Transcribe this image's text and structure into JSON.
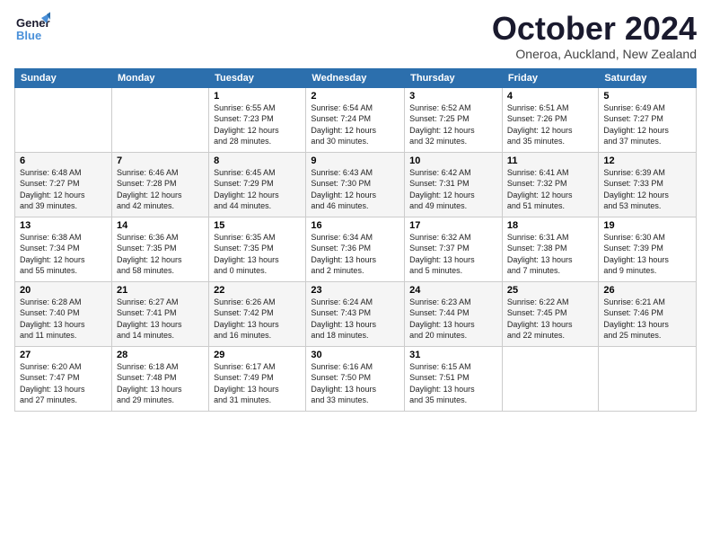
{
  "logo": {
    "line1": "General",
    "line2": "Blue"
  },
  "title": "October 2024",
  "location": "Oneroa, Auckland, New Zealand",
  "weekdays": [
    "Sunday",
    "Monday",
    "Tuesday",
    "Wednesday",
    "Thursday",
    "Friday",
    "Saturday"
  ],
  "rows": [
    [
      null,
      null,
      {
        "day": 1,
        "sunrise": "6:55 AM",
        "sunset": "7:23 PM",
        "daylight": "12 hours and 28 minutes."
      },
      {
        "day": 2,
        "sunrise": "6:54 AM",
        "sunset": "7:24 PM",
        "daylight": "12 hours and 30 minutes."
      },
      {
        "day": 3,
        "sunrise": "6:52 AM",
        "sunset": "7:25 PM",
        "daylight": "12 hours and 32 minutes."
      },
      {
        "day": 4,
        "sunrise": "6:51 AM",
        "sunset": "7:26 PM",
        "daylight": "12 hours and 35 minutes."
      },
      {
        "day": 5,
        "sunrise": "6:49 AM",
        "sunset": "7:27 PM",
        "daylight": "12 hours and 37 minutes."
      }
    ],
    [
      {
        "day": 6,
        "sunrise": "6:48 AM",
        "sunset": "7:27 PM",
        "daylight": "12 hours and 39 minutes."
      },
      {
        "day": 7,
        "sunrise": "6:46 AM",
        "sunset": "7:28 PM",
        "daylight": "12 hours and 42 minutes."
      },
      {
        "day": 8,
        "sunrise": "6:45 AM",
        "sunset": "7:29 PM",
        "daylight": "12 hours and 44 minutes."
      },
      {
        "day": 9,
        "sunrise": "6:43 AM",
        "sunset": "7:30 PM",
        "daylight": "12 hours and 46 minutes."
      },
      {
        "day": 10,
        "sunrise": "6:42 AM",
        "sunset": "7:31 PM",
        "daylight": "12 hours and 49 minutes."
      },
      {
        "day": 11,
        "sunrise": "6:41 AM",
        "sunset": "7:32 PM",
        "daylight": "12 hours and 51 minutes."
      },
      {
        "day": 12,
        "sunrise": "6:39 AM",
        "sunset": "7:33 PM",
        "daylight": "12 hours and 53 minutes."
      }
    ],
    [
      {
        "day": 13,
        "sunrise": "6:38 AM",
        "sunset": "7:34 PM",
        "daylight": "12 hours and 55 minutes."
      },
      {
        "day": 14,
        "sunrise": "6:36 AM",
        "sunset": "7:35 PM",
        "daylight": "12 hours and 58 minutes."
      },
      {
        "day": 15,
        "sunrise": "6:35 AM",
        "sunset": "7:35 PM",
        "daylight": "13 hours and 0 minutes."
      },
      {
        "day": 16,
        "sunrise": "6:34 AM",
        "sunset": "7:36 PM",
        "daylight": "13 hours and 2 minutes."
      },
      {
        "day": 17,
        "sunrise": "6:32 AM",
        "sunset": "7:37 PM",
        "daylight": "13 hours and 5 minutes."
      },
      {
        "day": 18,
        "sunrise": "6:31 AM",
        "sunset": "7:38 PM",
        "daylight": "13 hours and 7 minutes."
      },
      {
        "day": 19,
        "sunrise": "6:30 AM",
        "sunset": "7:39 PM",
        "daylight": "13 hours and 9 minutes."
      }
    ],
    [
      {
        "day": 20,
        "sunrise": "6:28 AM",
        "sunset": "7:40 PM",
        "daylight": "13 hours and 11 minutes."
      },
      {
        "day": 21,
        "sunrise": "6:27 AM",
        "sunset": "7:41 PM",
        "daylight": "13 hours and 14 minutes."
      },
      {
        "day": 22,
        "sunrise": "6:26 AM",
        "sunset": "7:42 PM",
        "daylight": "13 hours and 16 minutes."
      },
      {
        "day": 23,
        "sunrise": "6:24 AM",
        "sunset": "7:43 PM",
        "daylight": "13 hours and 18 minutes."
      },
      {
        "day": 24,
        "sunrise": "6:23 AM",
        "sunset": "7:44 PM",
        "daylight": "13 hours and 20 minutes."
      },
      {
        "day": 25,
        "sunrise": "6:22 AM",
        "sunset": "7:45 PM",
        "daylight": "13 hours and 22 minutes."
      },
      {
        "day": 26,
        "sunrise": "6:21 AM",
        "sunset": "7:46 PM",
        "daylight": "13 hours and 25 minutes."
      }
    ],
    [
      {
        "day": 27,
        "sunrise": "6:20 AM",
        "sunset": "7:47 PM",
        "daylight": "13 hours and 27 minutes."
      },
      {
        "day": 28,
        "sunrise": "6:18 AM",
        "sunset": "7:48 PM",
        "daylight": "13 hours and 29 minutes."
      },
      {
        "day": 29,
        "sunrise": "6:17 AM",
        "sunset": "7:49 PM",
        "daylight": "13 hours and 31 minutes."
      },
      {
        "day": 30,
        "sunrise": "6:16 AM",
        "sunset": "7:50 PM",
        "daylight": "13 hours and 33 minutes."
      },
      {
        "day": 31,
        "sunrise": "6:15 AM",
        "sunset": "7:51 PM",
        "daylight": "13 hours and 35 minutes."
      },
      null,
      null
    ]
  ]
}
